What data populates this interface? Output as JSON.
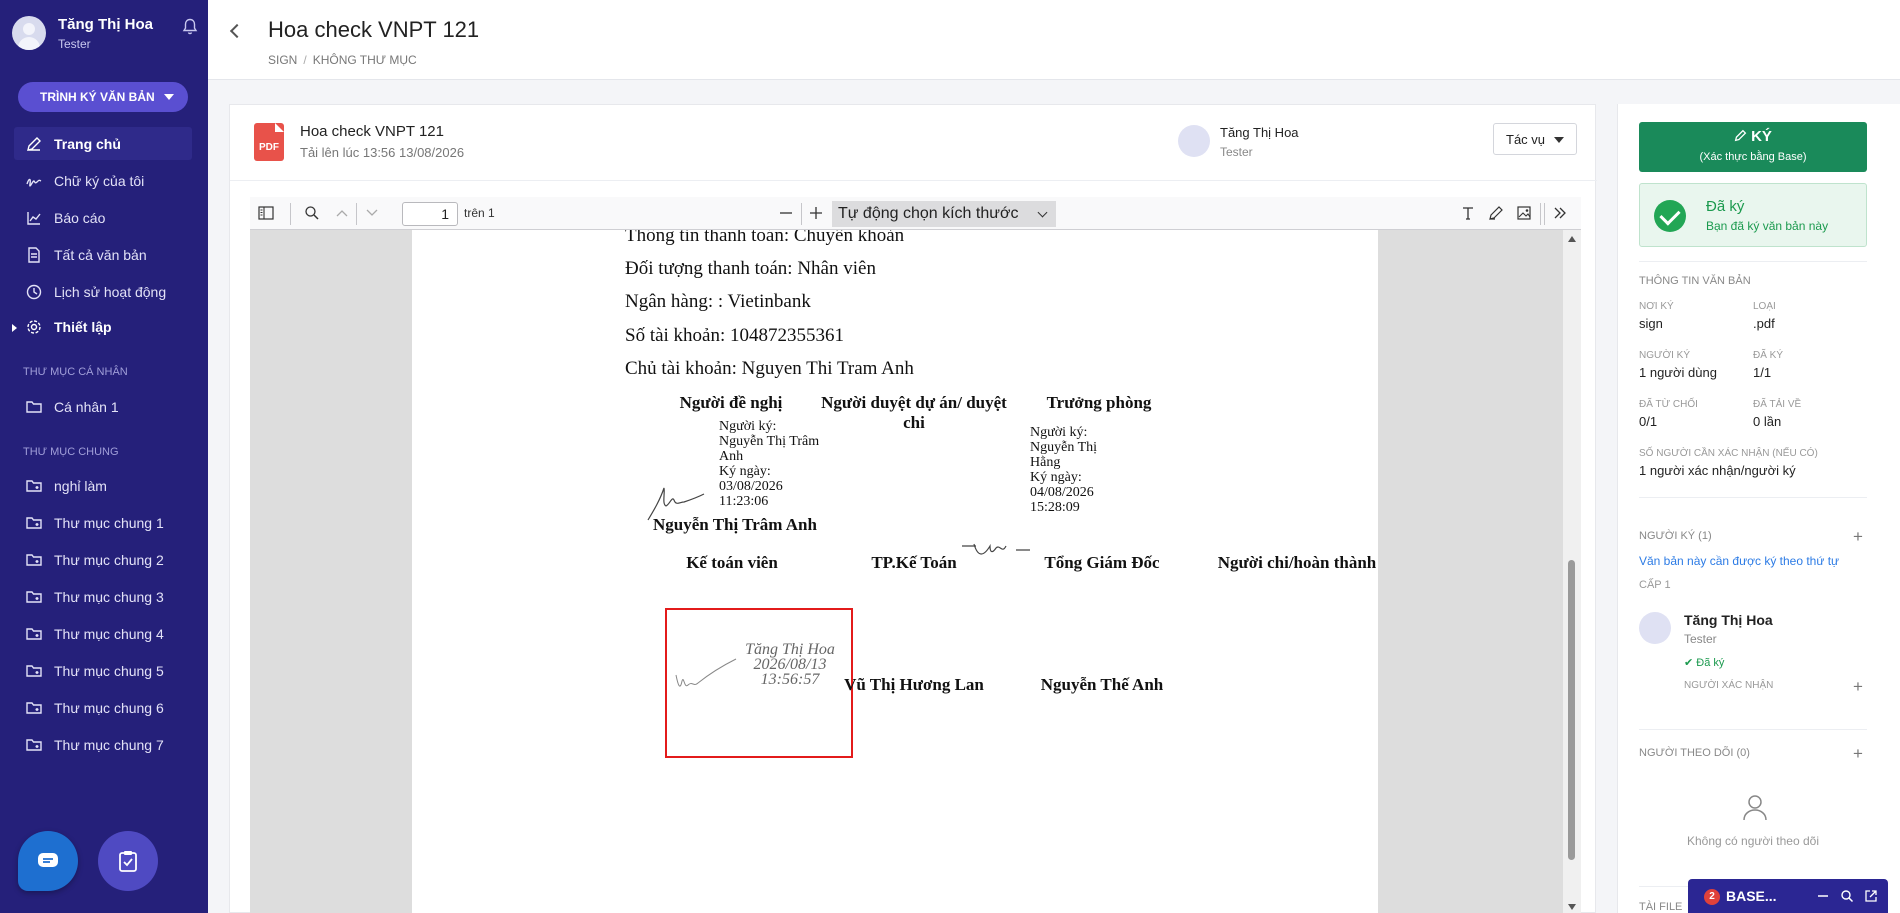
{
  "user": {
    "name": "Tăng Thị Hoa",
    "role": "Tester"
  },
  "sidebar": {
    "cta_label": "TRÌNH KÝ VĂN BẢN",
    "items": [
      {
        "label": "Trang chủ",
        "icon": "pen-icon"
      },
      {
        "label": "Chữ ký của tôi",
        "icon": "signature-icon"
      },
      {
        "label": "Báo cáo",
        "icon": "chart-icon"
      },
      {
        "label": "Tất cả văn bản",
        "icon": "document-icon"
      },
      {
        "label": "Lịch sử hoạt động",
        "icon": "clock-icon"
      },
      {
        "label": "Thiết lập",
        "icon": "gear-icon"
      }
    ],
    "personal_title": "THƯ MỤC CÁ NHÂN",
    "personal_items": [
      {
        "label": "Cá nhân 1"
      }
    ],
    "shared_title": "THƯ MỤC CHUNG",
    "shared_items": [
      {
        "label": "nghỉ làm"
      },
      {
        "label": "Thư mục chung 1"
      },
      {
        "label": "Thư mục chung 2"
      },
      {
        "label": "Thư mục chung 3"
      },
      {
        "label": "Thư mục chung 4"
      },
      {
        "label": "Thư mục chung 5"
      },
      {
        "label": "Thư mục chung 6"
      },
      {
        "label": "Thư mục chung 7"
      }
    ]
  },
  "header": {
    "title": "Hoa check VNPT 121",
    "breadcrumb": [
      "SIGN",
      "KHÔNG THƯ MỤC"
    ]
  },
  "file": {
    "icon_text": "PDF",
    "name": "Hoa check VNPT 121",
    "uploaded": "Tải lên lúc 13:56 13/08/2026",
    "owner_name": "Tăng Thị Hoa",
    "owner_role": "Tester",
    "action_label": "Tác vụ"
  },
  "viewer": {
    "page_value": "1",
    "page_of": "trên 1",
    "zoom": "Tự động chọn kích thước"
  },
  "pdf": {
    "lines": [
      "Thông tin thanh toán: Chuyển khoản",
      "Đối tượng thanh toán: Nhân viên",
      "Ngân hàng: : Vietinbank",
      "Số tài khoản: 104872355361",
      "Chủ tài khoản: Nguyen Thi Tram Anh"
    ],
    "role_proposer": "Người đề nghị",
    "role_approver": "Người duyệt dự án/ duyệt chi",
    "role_head": "Trưởng phòng",
    "sig1_text": "Người ký:\nNguyễn Thị Trâm\nAnh\nKý ngày:\n03/08/2026\n11:23:06",
    "sig2_text": "Người ký:\nNguyễn Thị\nHằng\nKý ngày:\n04/08/2026\n15:28:09",
    "proposer_name": "Nguyễn Thị Trâm Anh",
    "role_accountant": "Kế toán viên",
    "role_chief_accountant": "TP.Kế Toán",
    "role_director": "Tổng Giám Đốc",
    "role_payer": "Người chi/hoàn thành",
    "stamp_name": "Tăng Thị Hoa",
    "stamp_date": "2026/08/13",
    "stamp_time": "13:56:57",
    "chief_accountant_name": "Vũ Thị Hương Lan",
    "director_name": "Nguyễn Thế Anh"
  },
  "panel": {
    "sign_label": "KÝ",
    "sign_sub": "(Xác thực bằng Base)",
    "signed_title": "Đã ký",
    "signed_desc": "Bạn đã ký văn bản này",
    "info_title": "THÔNG TIN VĂN BẢN",
    "noi_ky_label": "NƠI KÝ",
    "noi_ky": "sign",
    "loai_label": "LOẠI",
    "loai": ".pdf",
    "nguoi_ky_label": "NGƯỜI KÝ",
    "nguoi_ky": "1 người dùng",
    "da_ky_label": "ĐÃ KÝ",
    "da_ky": "1/1",
    "tu_choi_label": "ĐÃ TỪ CHỐI",
    "tu_choi": "0/1",
    "tai_ve_label": "ĐÃ TẢI VỀ",
    "tai_ve": "0 lần",
    "xac_nhan_label": "SỐ NGƯỜI CẦN XÁC NHẬN (NẾU CÓ)",
    "xac_nhan": "1 người xác nhận/người ký",
    "signers_title": "NGƯỜI KÝ (1)",
    "order_note": "Văn bản này cần được ký theo thứ tự",
    "level": "CẤP 1",
    "signer_name": "Tăng Thị Hoa",
    "signer_role": "Tester",
    "signer_status": "Đã ký",
    "confirmer_title": "NGƯỜI XÁC NHẬN",
    "followers_title": "NGƯỜI THEO DÕI (0)",
    "no_followers": "Không có người theo dõi",
    "attach_title": "TÀI FILE"
  },
  "base_bar": {
    "badge": "2",
    "label": "BASE..."
  },
  "colors": {
    "sidebar": "#25207a",
    "accent": "#5a4fd1",
    "sign_green": "#1a8a5a",
    "highlight_red": "#e31b1b"
  }
}
